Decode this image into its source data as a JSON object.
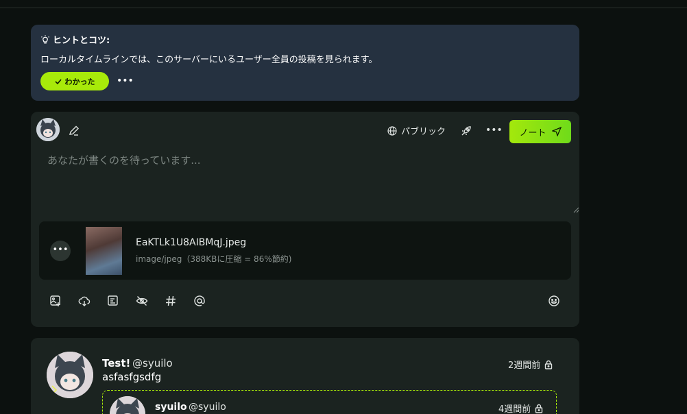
{
  "tips": {
    "title": "ヒントとコツ:",
    "body": "ローカルタイムラインでは、このサーバーにいるユーザー全員の投稿を見られます。",
    "gotit_label": "わかった"
  },
  "composer": {
    "visibility_label": "パブリック",
    "submit_label": "ノート",
    "placeholder": "あなたが書くのを待っています...",
    "attachment": {
      "filename": "EaKTLk1U8AIBMqJ.jpeg",
      "info": "image/jpeg（388KBに圧縮 = 86%節約)"
    }
  },
  "post": {
    "display_name": "Test!",
    "acct": "@syuilo",
    "text": "asfasfgsdfg",
    "time": "2週間前",
    "quote": {
      "display_name": "syuilo",
      "acct": "@syuilo",
      "time": "4週間前"
    }
  },
  "colors": {
    "accent": "#a8ea0a",
    "tips_bg": "#253140",
    "card_bg": "#1b2320"
  }
}
